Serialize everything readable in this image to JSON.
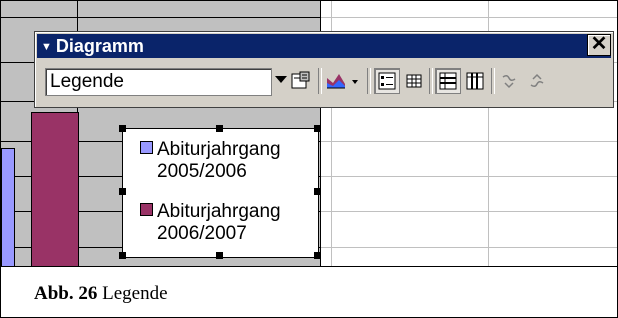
{
  "toolbar": {
    "title": "Diagramm",
    "close_symbol": "✕",
    "combo_value": "Legende",
    "icons": [
      "format-object-icon",
      "chart-type-icon",
      "legend-icon",
      "data-table-icon",
      "by-row-icon",
      "by-column-icon",
      "angle-text-downward-icon",
      "angle-text-upward-icon"
    ]
  },
  "legend": {
    "items": [
      {
        "line1": "Abiturjahrgang",
        "line2": "2005/2006",
        "color": "#9999ff"
      },
      {
        "line1": "Abiturjahrgang",
        "line2": "2006/2007",
        "color": "#993366"
      }
    ]
  },
  "caption": {
    "label": "Abb. 26",
    "text": " Legende"
  }
}
